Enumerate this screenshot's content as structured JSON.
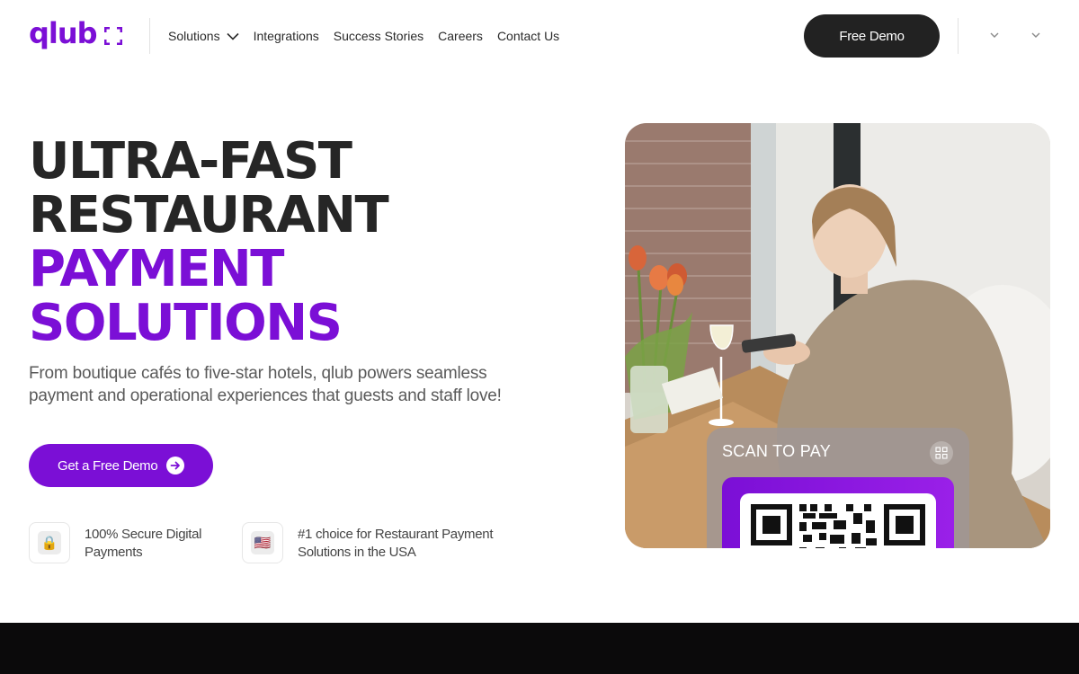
{
  "header": {
    "logo_text": "qlub",
    "nav": [
      {
        "label": "Solutions",
        "has_dropdown": true
      },
      {
        "label": "Integrations"
      },
      {
        "label": "Success Stories"
      },
      {
        "label": "Careers"
      },
      {
        "label": "Contact Us"
      }
    ],
    "demo_button": "Free Demo"
  },
  "hero": {
    "title_lines": [
      "ULTRA-FAST",
      "RESTAURANT"
    ],
    "title_highlight_lines": [
      "PAYMENT",
      "SOLUTIONS"
    ],
    "subtitle": "From boutique cafés to five-star hotels, qlub powers seamless payment and operational experiences that guests and staff love!",
    "cta_label": "Get a Free Demo",
    "badges": [
      {
        "icon": "lock-icon",
        "glyph": "🔒",
        "text": "100% Secure Digital Payments"
      },
      {
        "icon": "us-flag-icon",
        "glyph": "🇺🇸",
        "text": "#1 choice for Restaurant Payment Solutions in the USA"
      }
    ],
    "image": {
      "scan_label": "SCAN TO PAY"
    }
  },
  "colors": {
    "brand_purple": "#7b0fd6",
    "dark_button": "#222222",
    "footer_strip": "#0b0a0b"
  }
}
